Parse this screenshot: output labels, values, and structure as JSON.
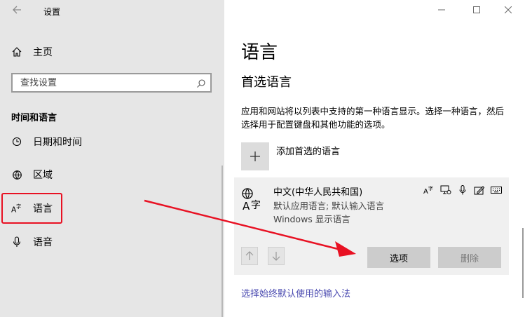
{
  "window": {
    "title": "设置",
    "back_icon": "arrow-left-icon",
    "minimize_icon": "minimize-icon",
    "maximize_icon": "maximize-icon",
    "close_icon": "close-icon"
  },
  "sidebar": {
    "home_label": "主页",
    "search_placeholder": "查找设置",
    "section_heading": "时间和语言",
    "items": [
      {
        "label": "日期和时间",
        "icon": "calendar-clock-icon"
      },
      {
        "label": "区域",
        "icon": "globe-icon"
      },
      {
        "label": "语言",
        "icon": "language-icon",
        "selected": true
      },
      {
        "label": "语音",
        "icon": "microphone-icon"
      }
    ]
  },
  "main": {
    "page_title": "语言",
    "section_title": "首选语言",
    "description": "应用和网站将以列表中支持的第一种语言显示。选择一种语言，然后选择用于配置键盘和其他功能的选项。",
    "add_label": "添加首选的语言",
    "language": {
      "name": "中文(中华人民共和国)",
      "sub1": "默认应用语言; 默认输入语言",
      "sub2": "Windows 显示语言"
    },
    "options_button": "选项",
    "delete_button": "删除",
    "input_link": "选择始终默认使用的输入法"
  },
  "colors": {
    "sidebar_bg": "#e6e6e6",
    "card_bg": "#f0f0f0",
    "annotation_red": "#e81123",
    "link": "#4a4ab0"
  }
}
